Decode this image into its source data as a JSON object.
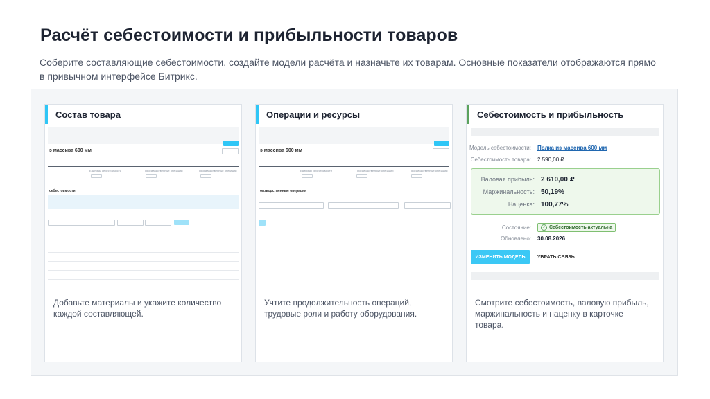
{
  "header": {
    "title": "Расчёт себестоимости и прибыльности товаров",
    "subtitle": "Соберите составляющие себестоимости, создайте модели расчёта и назначьте их товарам. Основные показатели отображаются прямо в привычном интерфейсе Битрикс."
  },
  "cards": [
    {
      "title": "Состав товара",
      "description": "Добавьте материалы и укажите количество каждой составляющей.",
      "mini": {
        "product_name": "э массива 600 мм",
        "section_title": "себестоимости",
        "steps": [
          "Единицы себестоимости",
          "Производственные операции",
          "Производственные операции"
        ]
      }
    },
    {
      "title": "Операции и ресурсы",
      "description": "Учтите продолжительность операций, трудовые роли и работу оборудования.",
      "mini": {
        "product_name": "э массива 600 мм",
        "section_title": "оизводственные операции",
        "steps": [
          "Единицы себестоимости",
          "Производственные операции",
          "Производственные операции"
        ]
      }
    },
    {
      "title": "Себестоимость и прибыльность",
      "description": "Смотрите себестоимость, валовую прибыль, маржинальность и наценку в карточке товара.",
      "details": {
        "model_label": "Модель себестоимости:",
        "model_value": "Полка из массива 600 мм",
        "cost_label": "Себестоимость товара:",
        "cost_value": "2 590,00 ₽",
        "gross_label": "Валовая прибыль:",
        "gross_value": "2 610,00 ₽",
        "margin_label": "Маржинальность:",
        "margin_value": "50,19%",
        "markup_label": "Наценка:",
        "markup_value": "100,77%",
        "state_label": "Состояние:",
        "state_value": "Себестоимость актуальна",
        "updated_label": "Обновлено:",
        "updated_value": "30.08.2026",
        "edit_button": "ИЗМЕНИТЬ МОДЕЛЬ",
        "unlink_button": "УБРАТЬ СВЯЗЬ"
      }
    }
  ],
  "colors": {
    "accent_blue": "#2fc6f6",
    "accent_green": "#5ba25d",
    "link": "#2067b0"
  }
}
